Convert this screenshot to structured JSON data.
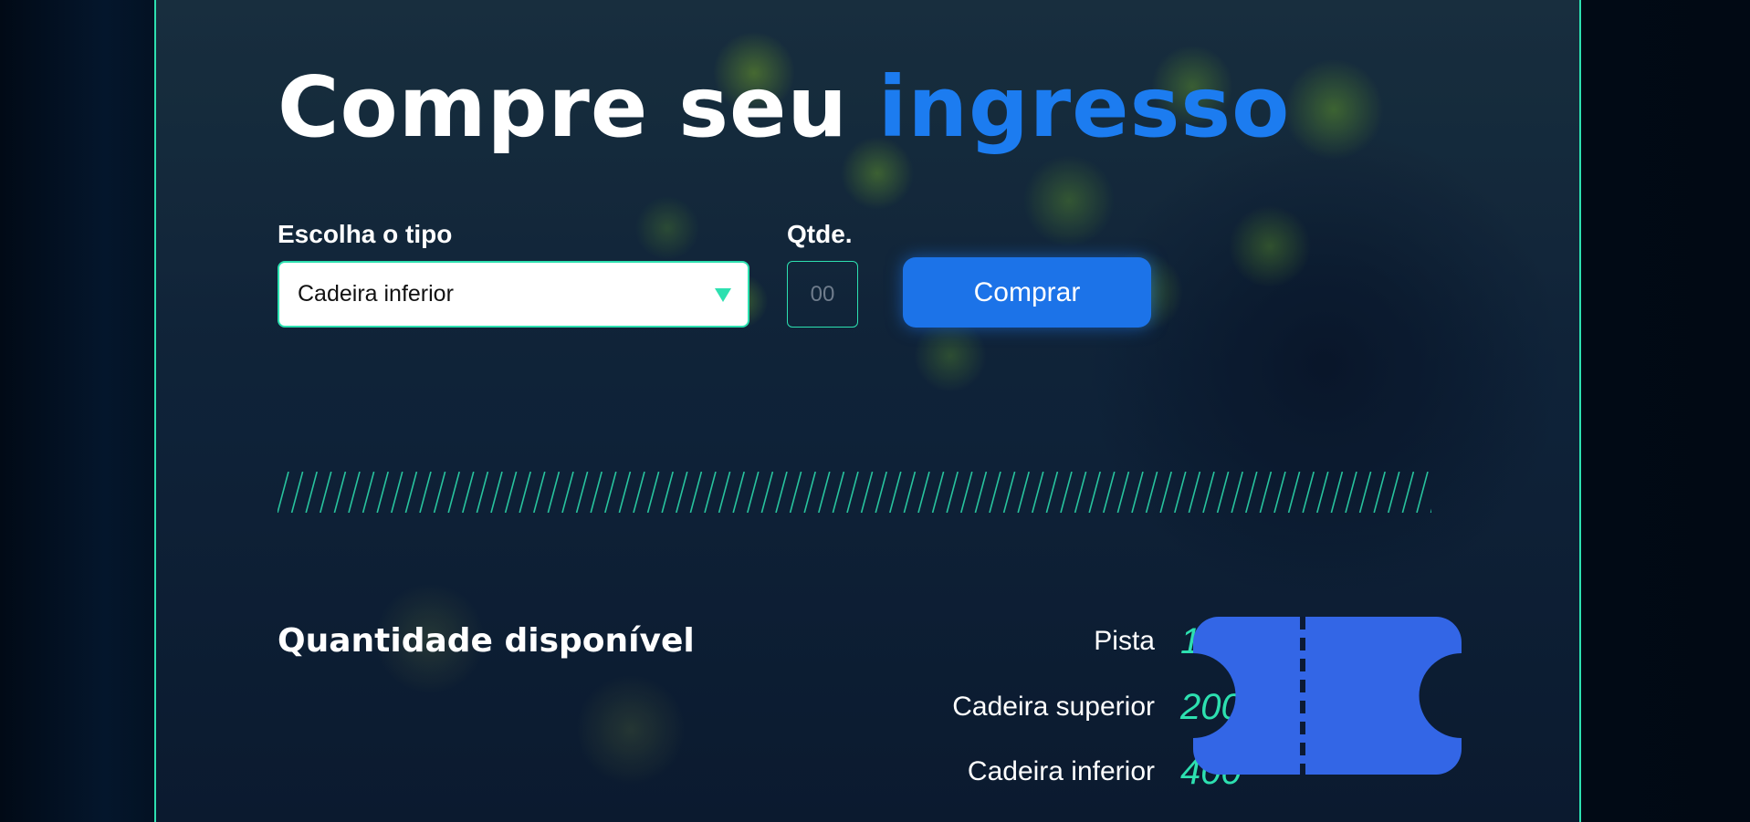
{
  "header": {
    "title_main": "Compre seu ",
    "title_accent": "ingresso"
  },
  "form": {
    "type_label": "Escolha o tipo",
    "type_selected": "Cadeira inferior",
    "qty_label": "Qtde.",
    "qty_placeholder": "00",
    "buy_label": "Comprar"
  },
  "availability": {
    "title": "Quantidade disponível",
    "rows": [
      {
        "label": "Pista",
        "value": "100"
      },
      {
        "label": "Cadeira superior",
        "value": "200"
      },
      {
        "label": "Cadeira inferior",
        "value": "400"
      }
    ]
  },
  "icons": {
    "dropdown": "chevron-down-icon",
    "ticket": "ticket-icon"
  },
  "colors": {
    "accent_blue": "#1c7cf0",
    "accent_green": "#2de0b0",
    "button_blue": "#1c73e8",
    "ticket_blue": "#3366e6"
  }
}
